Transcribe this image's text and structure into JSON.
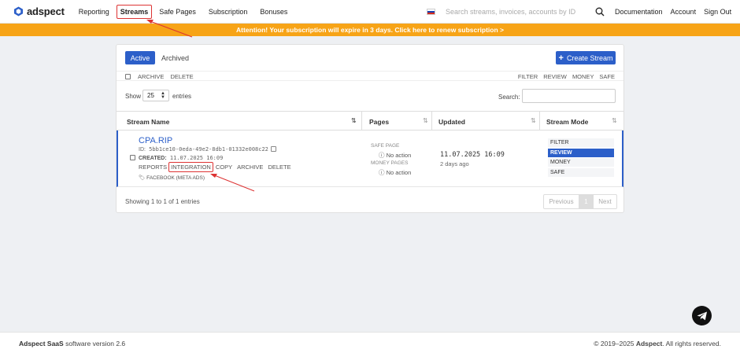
{
  "app": {
    "logo_text": "adspect"
  },
  "nav": {
    "items": [
      "Reporting",
      "Streams",
      "Safe Pages",
      "Subscription",
      "Bonuses"
    ],
    "search_placeholder": "Search streams, invoices, accounts by ID",
    "right": [
      "Documentation",
      "Account",
      "Sign Out"
    ]
  },
  "banner": {
    "text": "Attention! Your subscription will expire in 3 days. Click here to renew subscription >"
  },
  "toolbar": {
    "tab_active": "Active",
    "tab_archived": "Archived",
    "create_label": "Create Stream",
    "bulk_actions": [
      "ARCHIVE",
      "DELETE"
    ],
    "mode_filters": [
      "FILTER",
      "REVIEW",
      "MONEY",
      "SAFE"
    ]
  },
  "table_controls": {
    "show_label": "Show",
    "page_size": "25",
    "entries_label": "entries",
    "search_label": "Search:"
  },
  "columns": [
    "Stream Name",
    "Pages",
    "Updated",
    "Stream Mode"
  ],
  "rows": [
    {
      "name": "CPA.RIP",
      "id_label": "ID:",
      "id": "5bb1ce10-0eda-49e2-8db1-01332e008c22",
      "created_label": "CREATED:",
      "created": "11.07.2025 16:09",
      "actions": [
        "REPORTS",
        "INTEGRATION",
        "COPY",
        "ARCHIVE",
        "DELETE"
      ],
      "tag": "FACEBOOK (META ADS)",
      "safe_page_label": "SAFE PAGE",
      "safe_page_value": "No action",
      "money_pages_label": "MONEY PAGES",
      "money_pages_value": "No action",
      "updated": "11.07.2025 16:09",
      "updated_relative": "2 days ago",
      "modes": [
        "FILTER",
        "REVIEW",
        "MONEY",
        "SAFE"
      ],
      "selected_mode": "REVIEW"
    }
  ],
  "footer_table": {
    "showing": "Showing 1 to 1 of 1 entries",
    "prev": "Previous",
    "page": "1",
    "next": "Next"
  },
  "footer": {
    "brand": "Adspect SaaS",
    "version_text": "software version 2.6",
    "copyright_prefix": "© 2019–2025",
    "copyright_brand": "Adspect",
    "copyright_suffix": ". All rights reserved."
  },
  "colors": {
    "accent": "#2c5fc9",
    "banner": "#f7a417",
    "highlight": "#d33333"
  }
}
